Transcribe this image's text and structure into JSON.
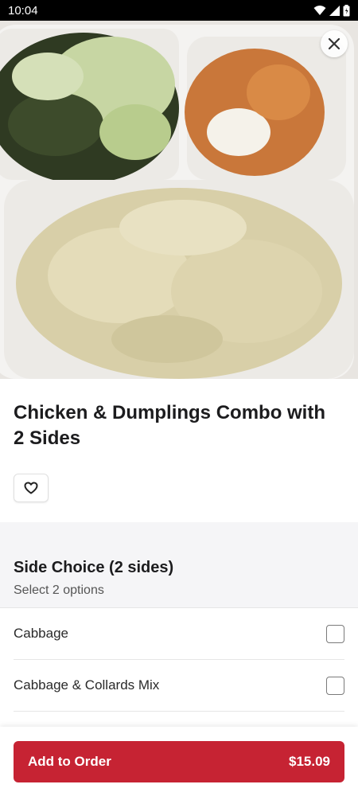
{
  "status_bar": {
    "time": "10:04"
  },
  "item": {
    "title": "Chicken & Dumplings Combo with 2 Sides"
  },
  "modifier_group": {
    "title": "Side Choice (2 sides)",
    "subtitle": "Select 2 options",
    "options": [
      {
        "label": "Cabbage",
        "selected": false
      },
      {
        "label": "Cabbage & Collards Mix",
        "selected": false
      }
    ]
  },
  "footer": {
    "add_label": "Add to Order",
    "price": "$15.09"
  },
  "colors": {
    "primary": "#c62333",
    "section_bg": "#f5f5f7"
  }
}
